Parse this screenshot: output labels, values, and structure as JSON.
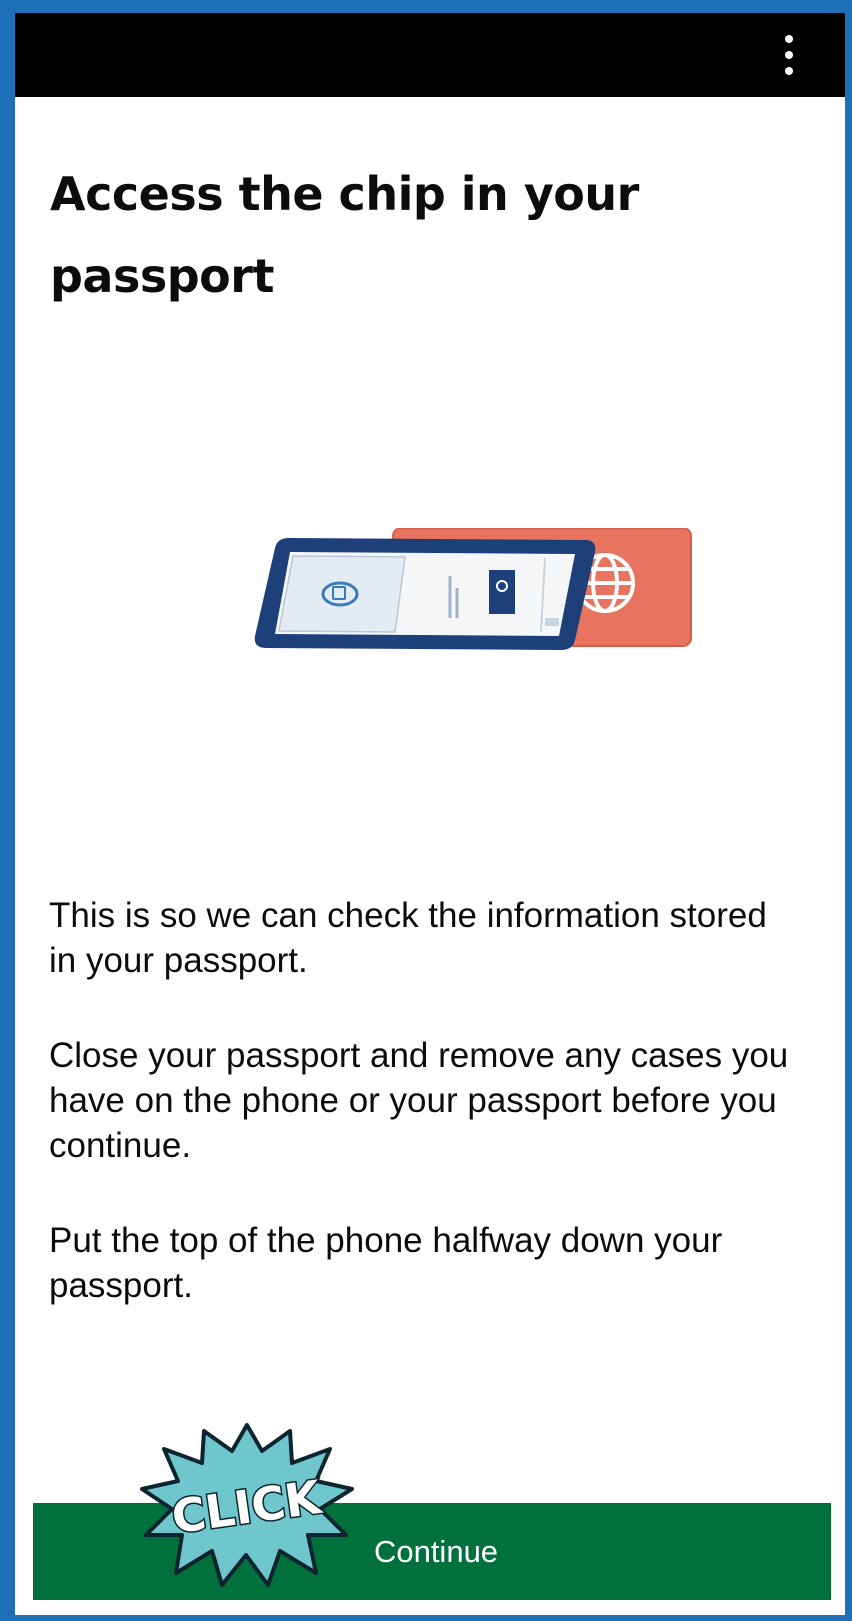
{
  "header": {
    "menu_icon": "more-vertical-icon"
  },
  "page": {
    "title": "Access the chip in your passport",
    "paragraphs": [
      "This is so we can check the information stored in your passport.",
      "Close your passport and remove any cases you have on the phone or your passport before you continue.",
      "Put the top of the phone halfway down your passport."
    ],
    "illustration_icon": "phone-on-passport-illustration"
  },
  "actions": {
    "continue_label": "Continue"
  },
  "overlay": {
    "sticker_text": "CLICK"
  },
  "colors": {
    "frame": "#1f6fb8",
    "topbar": "#000000",
    "button": "#00703c",
    "passport": "#e8735f",
    "phone": "#1d3f7a",
    "sticker": "#6fc6cc"
  }
}
